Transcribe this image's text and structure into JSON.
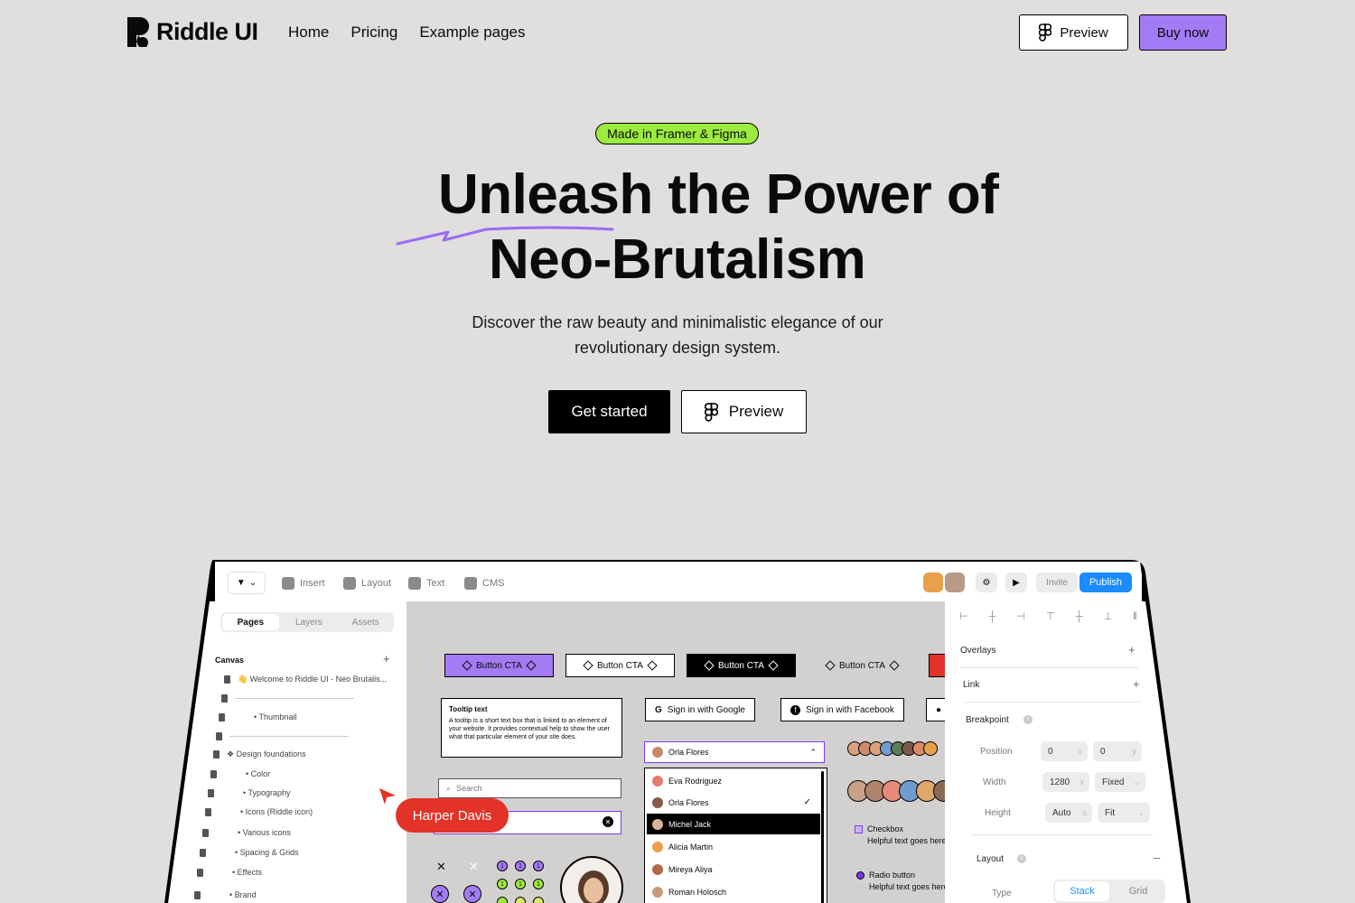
{
  "nav": {
    "brand": "Riddle UI",
    "links": [
      "Home",
      "Pricing",
      "Example pages"
    ],
    "preview_label": "Preview",
    "buy_label": "Buy now"
  },
  "hero": {
    "badge": "Made in Framer & Figma",
    "title_line1": "Unleash the Power of",
    "title_line2": "Neo-Brutalism",
    "subtitle": "Discover the raw beauty and minimalistic elegance of our revolutionary design system.",
    "cta_primary": "Get started",
    "cta_secondary": "Preview"
  },
  "mockup": {
    "toolbar": {
      "insert": "Insert",
      "layout": "Layout",
      "text": "Text",
      "cms": "CMS",
      "invite": "Invite",
      "publish": "Publish"
    },
    "left_panel": {
      "tabs": [
        "Pages",
        "Layers",
        "Assets"
      ],
      "active_tab": "Pages",
      "canvas_label": "Canvas",
      "tree": [
        "👋 Welcome to Riddle UI - Neo Brutalis...",
        "--------------------------------------------",
        "• Thumbnail",
        "--------------------------------------------",
        "❖ Design foundations",
        "• Color",
        "• Typography",
        "• Icons (Riddle icon)",
        "• Various icons",
        "• Spacing & Grids",
        "• Effects",
        "• Brand"
      ]
    },
    "canvas": {
      "button_cta": "Button CTA",
      "tooltip_title": "Tooltip text",
      "tooltip_body": "A tooltip is a short text box that is linked to an element of your website. It provides contextual help to show the user what that particular element of your site does.",
      "search_placeholder": "Search",
      "cursor_name": "Harper Davis",
      "google_label": "Sign in with Google",
      "facebook_label": "Sign in with Facebook",
      "select_value": "Orla Flores",
      "dropdown_items": [
        "Eva Rodriguez",
        "Orla Flores",
        "Michel Jack",
        "Alicia Martin",
        "Mireya Aliya",
        "Roman Holosch"
      ],
      "dropdown_selected": "Orla Flores",
      "dropdown_highlight": "Michel Jack",
      "checkbox_label": "Checkbox",
      "checkbox_help": "Helpful text goes here.",
      "radio_label": "Radio button",
      "radio_help": "Helpful text goes here.",
      "step_number": "1"
    },
    "right_panel": {
      "overlays": "Overlays",
      "link": "Link",
      "breakpoint": "Breakpoint",
      "position_label": "Position",
      "position_x": "0",
      "position_y": "0",
      "x_unit": "x",
      "y_unit": "y",
      "width_label": "Width",
      "width_value": "1280",
      "width_mode": "Fixed",
      "height_label": "Height",
      "height_value": "Auto",
      "height_mode": "Fit",
      "layout_label": "Layout",
      "type_label": "Type",
      "type_options": [
        "Stack",
        "Grid"
      ],
      "type_active": "Stack"
    },
    "colors": {
      "purple": "#a37bf5",
      "green": "#9ceb3f",
      "red": "#e33227",
      "blue": "#1a8cff"
    }
  }
}
